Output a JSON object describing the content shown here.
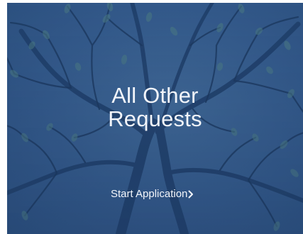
{
  "card": {
    "title_line1": "All Other",
    "title_line2": "Requests",
    "cta_label": "Start Application",
    "cta_icon": "chevron-right-icon",
    "background_color": "#33598a",
    "text_color": "#f2f5fa"
  }
}
